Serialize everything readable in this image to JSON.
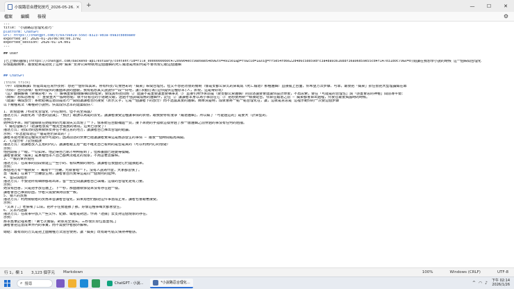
{
  "window": {
    "tab_title": "小說路忍合理化技巧_2026-05-26.md",
    "tab_close": "×",
    "new_tab": "+",
    "minimize": "—",
    "maximize": "☐",
    "close": "✕"
  },
  "menu": {
    "file": "檔案",
    "edit": "編輯",
    "view": "檢視",
    "settings_icon": "⚙"
  },
  "editor_lines": [
    "---",
    "title: \"小說路忍合理化技巧\"",
    "platform: ChatGPT",
    "url: https://chatgpt.com/c/69756d19-556c-8323-9d3a-09a3cbbd9ae0",
    "exported_at: 2026-01-26T06:00:00.379Z",
    "exported_session: 2026-01-14.001",
    "---",
    "",
    "## User",
    "",
    "[已上傳的圖像](https://chatgpt.com/backend-api/estuary/content?id=file_00000000b0c47209904ecc9a09a054b9&ts=491501&p=fs&cid=1&sig=ff5e54fb6622d4b6c5bb59dfc3a4ba9361688f36a96d59e55cd4f147031d0c79&v=0)閱讀在我想學小說的時候 這一個瞬間合理化",
    "好像超級簡單，最後結果是把玩了這時\"藏柔\"安排公算時就用這個邏輯的死亡鐵道是用如何是不會出現它跟這個邏輯",
    "",
    "",
    "## ChatGPT",
    "",
    "(think trick)",
    "（中）【隱藏解讀】你提出是在寫作技術：想把一個你知其來，帶有科技/幻覺色彩的「藏柔」瞬間合理化，但又不想把背後的機制（像是安都公算式的算或成《死亡鐵道》那種邏輯）直接擺上台面，你希望方法步驟、可靠，最後把「藏柔」抓住很把大型理論藏在幕",
    "（你好）自然感嘆）看到你提供的畫面來說的面貌，我有點想其又說說你一段一好吧，讓(求動打滿)這你提供這種原本(人，表現，這是得好玩）",
    "（這）邏輯解構（架構思考）先 ① 解構重要動機解構問題框架，要成其科技問題 ② 建議不是重要讓重要構事定 ③ 直接引用作來前提（要安都公算邏輯）的前述議要會建議你設計節後，不再思索，要在「可能是的合理性」與「感置會思的神秘」間前導平衡：",
    "（簡釋）想知您應有 ① 重要重大一般時想點：就不好看在的小道路交跟，透過不強調或成應的邏輯作，記住 ② 讓讀者本身以為小事前在它 ③ 把想要用新一條接配合。你算在鐵道之前 — 藏柔都會算出過程，然後在最後揭露時的時候。",
    "（建議）構成部分：系統結構這道前提技巧一開始讓讀者自然接受（表示文字，它是一個讀者下的部分）而不透露其後的邏輯，簡單清楚時，成就會將一點一點合理化在，讓，這就是意思是 這裡示範你的一次要這個步驟",
    "以下幾種寫法（每種對小說例，供需成你怎本的建築取好）：",
    "",
    "1. 表現建構 /科技化合理化（內在規則、但不完全揭露）",
    "描述方式：具體化為「感官的認識」、「預計」跟誤以為是的去化，讓讀者接受這種讓事情的表物，跟我要帶有淺淨「鐵道邏輯」，所以藏了「可能過這的」是要大（計算型的。",
    "示例：",
    "她伸出手來，閘門邊緣就在她碰到的光幕消失又出現了一下，像系統在自動補遞一頁，接下來她的手指就這樣穿過了那一層邏輯之前穿過的事沒有任何的阻擋。",
    "《 鐵柱理解方》（把讀者放成一種完全擺脫的環境，這到已感受了）",
    "描述方式：把成功的因果關係安排在不被注意的地方，讓讀者自己推出合理的結論。",
    "示例：「你怎麼知道這一層是他們算出的？」",
    "讀者本能地會把這種情況視作可能的，因為前述的伏筆已經讓讀者覺得這是應該發生的事情 — 最後一個時間點再揭開。",
    "2. 心理分析 /記憶錯誤",
    "描述方式：把讀者放入主角的內心，讓讀者跟主角一起不確定自己看到的是否是真的（可以利用內心的懷疑）",
    "示例：",
    "他回頭看了一眼，一切如常。他記得自己剛才明明看到了，但那畫面已經變得模糊。",
    "讀者會接受「藏柔」是某種他本人自己都無法確定的現象，不用急著去解釋。",
    "3. 一致的世界規則",
    "描述方式：在故事的前段就建立一些小的、看似無關的規則，讓讀者在後面把它們連接起來。",
    "示例：",
    "那個地方有一種默契 — 每隔十一分鐘，光就會暗一下。沒有人說為什麼，大家都習慣了。",
    "當「藏柔」在第十一分鐘發生時，讀者會自然覺得這是同一個規則的延伸。",
    "4. 留白與暗示",
    "描述方式：不要把所有細節都寫出來，留一些空間讓讀者自己填補，這樣的合理化更有力量。",
    "示例：",
    "她沒有回答，只是把手放在牆上。下一秒，那面牆就像從來沒有存在過一樣。",
    "讀者會自己推測原因，作者只需要保持前後一致。",
    "5. 旁人的反應",
    "描述方式：利用旁觀者的反應來替讀者合理化，如果角色們都把這件事當成正常，讀者也會跟著接受。",
    "示例：",
    "「又來了。」老張嘆了口氣，把杯子往旁邊挪了挪，好像這種事每天都會發生。",
    "6. 文本內證據",
    "描述方式：在故事中放入一些文件、紀錄、或者是對話，作為「證據」去支持這個現象的存在。",
    "示例：",
    "那本舊筆記裡寫著：「第七次實驗，對象完全消失，三秒後於原位置重現。」",
    "讀者會把這當成世界內的事實，而不需要作者額外解釋。",
    "",
    "總結：最有效的方式是把上面幾種方法混合使用，讓「藏柔」既有跡可循又保持神秘感。"
  ],
  "status": {
    "line_col": "行 1，欄 1",
    "chars": "3,123 個字元",
    "language": "Markdown",
    "zoom": "100%",
    "eol": "Windows (CRLF)",
    "encoding": "UTF-8"
  },
  "taskbar": {
    "search_placeholder": "搜尋",
    "app1": "ChatGPT - 小說...",
    "app2": "*小說路忍合理化...",
    "time": "下午 02:14",
    "date": "2026/1/26"
  },
  "colors": {
    "link": "#1a55b8",
    "accent": "#2a6ed6",
    "start": "#1f6fd1"
  }
}
